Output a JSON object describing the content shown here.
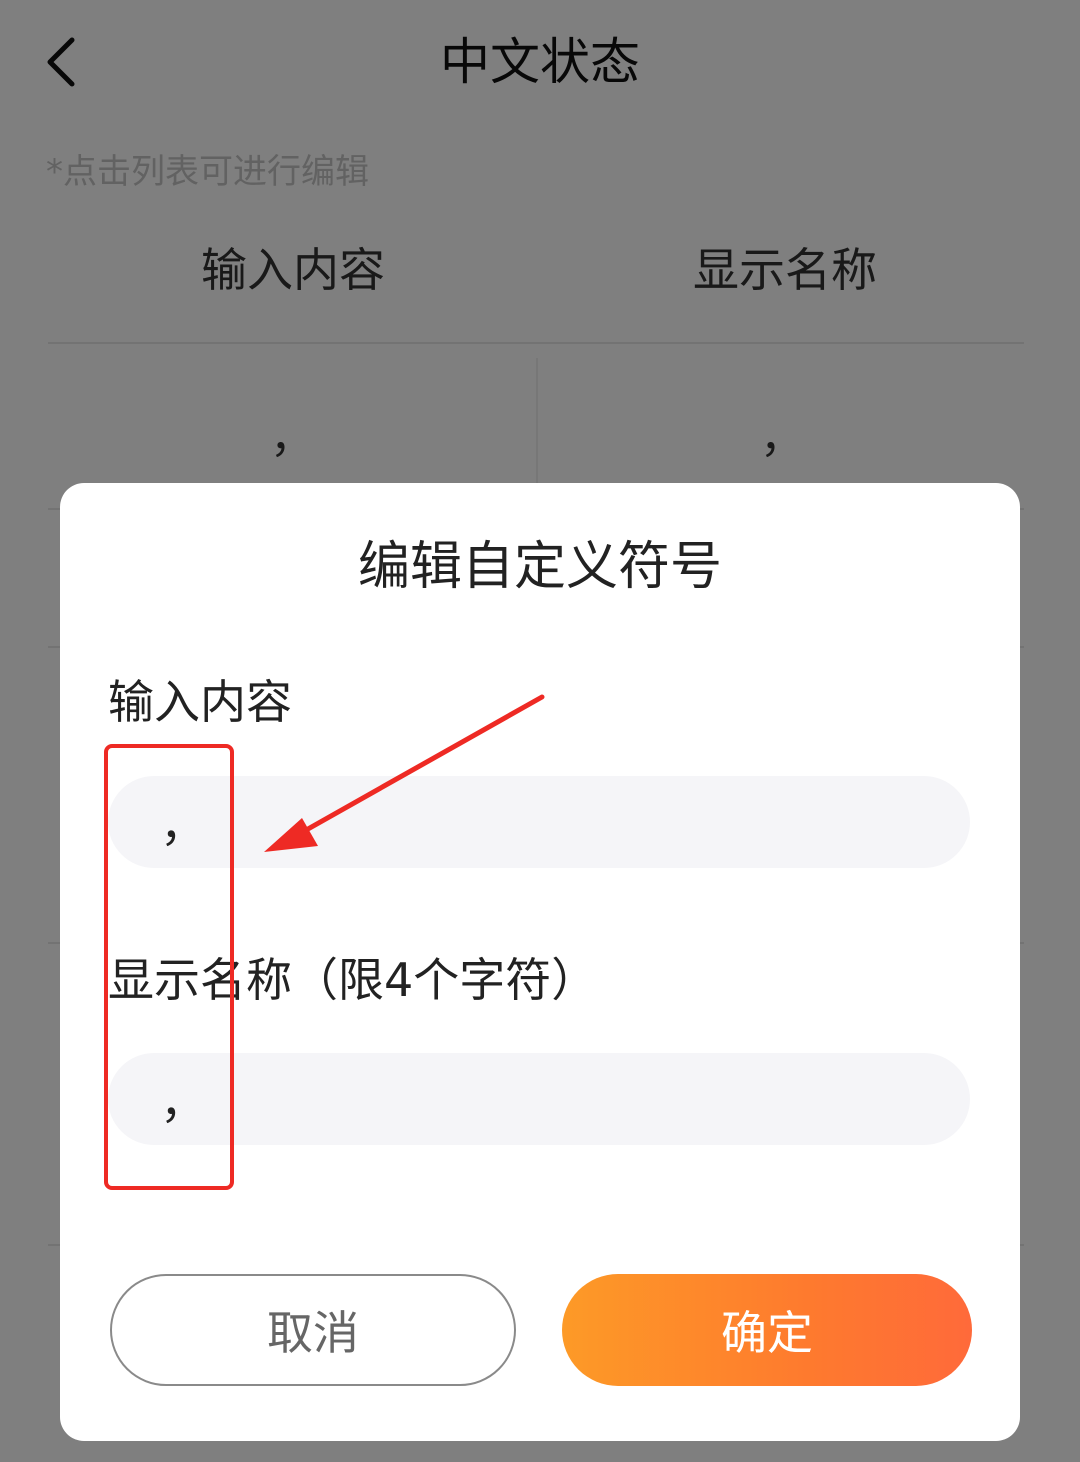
{
  "header": {
    "title": "中文状态",
    "back_icon": "chevron-left-icon"
  },
  "list": {
    "hint": "*点击列表可进行编辑",
    "columns": [
      "输入内容",
      "显示名称"
    ],
    "rows": [
      {
        "input": "，",
        "display": "，"
      },
      {
        "input": "",
        "display": ""
      },
      {
        "input": "",
        "display": ""
      },
      {
        "input": "",
        "display": ""
      },
      {
        "input": "",
        "display": ""
      },
      {
        "input": "",
        "display": ""
      }
    ]
  },
  "dialog": {
    "title": "编辑自定义符号",
    "input_label": "输入内容",
    "input_value": "，",
    "display_label": "显示名称（限4个字符）",
    "display_value": "，",
    "cancel_label": "取消",
    "confirm_label": "确定"
  },
  "colors": {
    "accent_start": "#fd9a27",
    "accent_end": "#ff6a3a",
    "highlight": "#ee2a24"
  }
}
